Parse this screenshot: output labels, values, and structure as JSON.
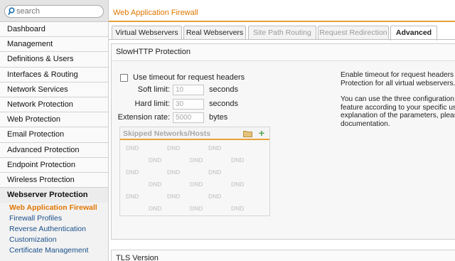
{
  "search": {
    "placeholder": "search"
  },
  "sidebar": {
    "items": [
      {
        "label": "Dashboard"
      },
      {
        "label": "Management"
      },
      {
        "label": "Definitions & Users"
      },
      {
        "label": "Interfaces & Routing"
      },
      {
        "label": "Network Services"
      },
      {
        "label": "Network Protection"
      },
      {
        "label": "Web Protection"
      },
      {
        "label": "Email Protection"
      },
      {
        "label": "Advanced Protection"
      },
      {
        "label": "Endpoint Protection"
      },
      {
        "label": "Wireless Protection"
      }
    ],
    "group_label": "Webserver Protection",
    "sub_items": [
      {
        "label": "Web Application Firewall",
        "active": true
      },
      {
        "label": "Firewall Profiles"
      },
      {
        "label": "Reverse Authentication"
      },
      {
        "label": "Customization"
      },
      {
        "label": "Certificate Management"
      }
    ]
  },
  "header": {
    "title": "Web Application Firewall"
  },
  "tabs": [
    {
      "label": "Virtual Webservers"
    },
    {
      "label": "Real Webservers"
    },
    {
      "label": "Site Path Routing",
      "disabled": true
    },
    {
      "label": "Request Redirection",
      "disabled": true
    },
    {
      "label": "Advanced",
      "active": true
    }
  ],
  "slowhttp": {
    "title": "SlowHTTP Protection",
    "checkbox_label": "Use timeout for request headers",
    "soft_limit": {
      "label": "Soft limit:",
      "value": "10",
      "unit": "seconds"
    },
    "hard_limit": {
      "label": "Hard limit:",
      "value": "30",
      "unit": "seconds"
    },
    "extension_rate": {
      "label": "Extension rate:",
      "value": "5000",
      "unit": "bytes"
    },
    "skipped": {
      "title": "Skipped Networks/Hosts",
      "placeholder": "DND"
    },
    "help": [
      "Enable timeout for request headers to a",
      "Protection for all virtual webservers.",
      "You can use the three configuration pa",
      "feature according to your specific usag",
      "explanation of the parameters, please c",
      "documentation."
    ]
  },
  "tls": {
    "title": "TLS Version"
  },
  "colors": {
    "accent": "#e07600",
    "link": "#1a4f8b",
    "add": "#52a852"
  }
}
